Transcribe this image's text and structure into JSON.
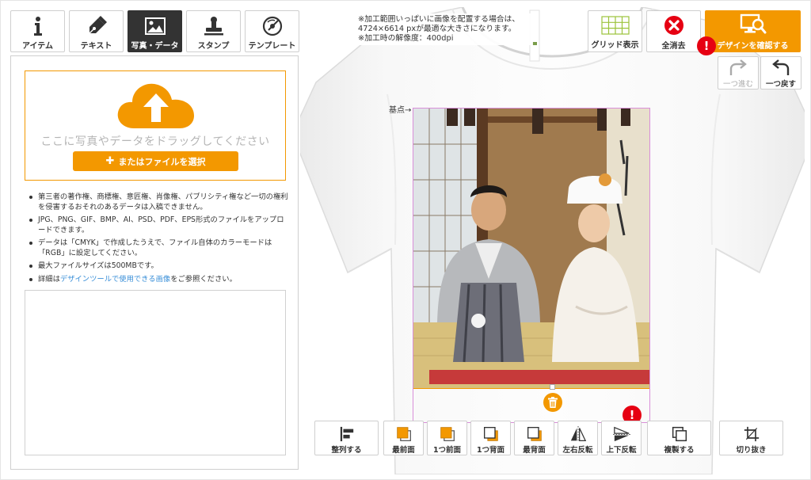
{
  "tabs": [
    {
      "id": "item",
      "label": "アイテム",
      "icon": "info-icon",
      "active": false
    },
    {
      "id": "text",
      "label": "テキスト",
      "icon": "pen-icon",
      "active": false
    },
    {
      "id": "photo",
      "label": "写真・データ",
      "icon": "image-icon",
      "active": true
    },
    {
      "id": "stamp",
      "label": "スタンプ",
      "icon": "stamp-icon",
      "active": false
    },
    {
      "id": "template",
      "label": "テンプレート",
      "icon": "template-icon",
      "active": false
    }
  ],
  "upload": {
    "icon": "cloud-upload-icon",
    "drop_text": "ここに写真やデータをドラッグしてください",
    "select_button": "またはファイルを選択"
  },
  "notes": [
    {
      "text": "第三者の著作権、商標権、意匠権、肖像権、パブリシティ権など一切の権利を侵害するおそれのあるデータは入稿できません。"
    },
    {
      "text": "JPG、PNG、GIF、BMP、AI、PSD、PDF、EPS形式のファイルをアップロードできます。"
    },
    {
      "text": "データは「CMYK」で作成したうえで、ファイル自体のカラーモードは「RGB」に設定してください。"
    },
    {
      "text": "最大ファイルサイズは500MBです。"
    },
    {
      "prefix": "詳細は",
      "link": "デザインツールで使用できる画像",
      "suffix": "をご参照ください。"
    }
  ],
  "info": {
    "line1": "※加工範囲いっぱいに画像を配置する場合は、",
    "line2": "4724×6614 pxが最適な大きさになります。",
    "line3": "※加工時の解像度：400dpi"
  },
  "header_buttons": {
    "grid": "グリッド表示",
    "clear": "全消去",
    "confirm": "デザインを確認する",
    "alert_mark": "!"
  },
  "history": {
    "redo": "一つ進む",
    "undo": "一つ戻す"
  },
  "canvas": {
    "origin_label": "基点→",
    "alert_mark": "!"
  },
  "toolbar": [
    {
      "label": "整列する",
      "icon": "align-icon"
    },
    {
      "label": "最前面",
      "icon": "bring-front-icon"
    },
    {
      "label": "1つ前面",
      "icon": "bring-forward-icon"
    },
    {
      "label": "1つ背面",
      "icon": "send-backward-icon"
    },
    {
      "label": "最背面",
      "icon": "send-back-icon"
    },
    {
      "label": "左右反転",
      "icon": "flip-horizontal-icon"
    },
    {
      "label": "上下反転",
      "icon": "flip-vertical-icon"
    },
    {
      "label": "複製する",
      "icon": "duplicate-icon"
    },
    {
      "label": "切り抜き",
      "icon": "crop-icon"
    }
  ],
  "colors": {
    "accent": "#f39800",
    "alert": "#e60012",
    "link": "#3a8fd8",
    "active_tab": "#333333"
  }
}
